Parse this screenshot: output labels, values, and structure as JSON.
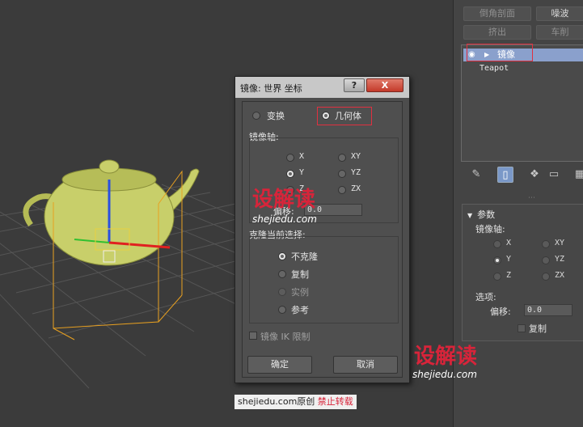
{
  "command_panel": {
    "buttons": [
      "倒角剖面",
      "噪波",
      "挤出",
      "车削"
    ],
    "stack": {
      "mirror": "镜像",
      "teapot": "Teapot"
    },
    "rollout": {
      "title": "参数",
      "axis_label": "镜像轴:",
      "axes": [
        "X",
        "XY",
        "Y",
        "YZ",
        "Z",
        "ZX"
      ],
      "selected_axis": "Y",
      "options_label": "选项:",
      "offset_label": "偏移:",
      "offset_value": "0.0",
      "copy_label": "复制"
    }
  },
  "dialog": {
    "title": "镜像: 世界 坐标",
    "help": "?",
    "close": "X",
    "transform_label": "变换",
    "geometry_label": "几何体",
    "axis_group_label": "镜像轴:",
    "axes": [
      "X",
      "XY",
      "Y",
      "YZ",
      "Z",
      "ZX"
    ],
    "selected_axis": "Y",
    "offset_label": "偏移:",
    "offset_value": "0.0",
    "clone_group_label": "克隆当前选择:",
    "clone_options": [
      "不克隆",
      "复制",
      "实例",
      "参考"
    ],
    "selected_clone": "不克隆",
    "mirror_ik_label": "镜像 IK 限制",
    "ok_label": "确定",
    "cancel_label": "取消"
  },
  "watermarks": {
    "logo_red": "设",
    "logo_gray": "解读",
    "url": "shejiedu.com",
    "credit_site": "shejiedu.com原创",
    "credit_notice": "禁止转载"
  },
  "colors": {
    "teapot": "#c8cf6a",
    "selection_box": "#e8a020",
    "highlight": "#e03040",
    "stack_selected": "#8aa0cc"
  }
}
